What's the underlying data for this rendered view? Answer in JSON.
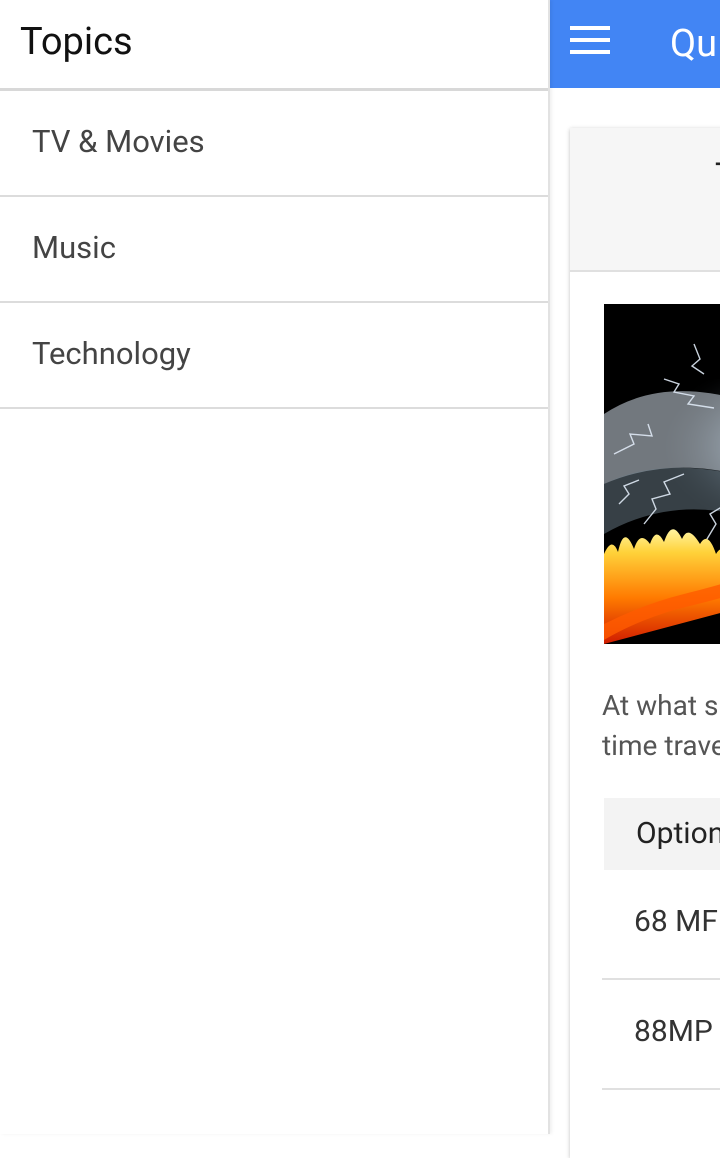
{
  "drawer": {
    "title": "Topics",
    "items": [
      {
        "label": "TV & Movies"
      },
      {
        "label": "Music"
      },
      {
        "label": "Technology"
      }
    ]
  },
  "appbar": {
    "menu_icon": "hamburger-menu-icon",
    "title": "Qu",
    "color": "#4285f4"
  },
  "card": {
    "header_text": "T",
    "image": "lightning-fire-image",
    "question_line1": "At what s",
    "question_line2": "time trave",
    "options_header": "Option",
    "options": [
      {
        "label": "68 MF"
      },
      {
        "label": "88MP"
      }
    ]
  }
}
